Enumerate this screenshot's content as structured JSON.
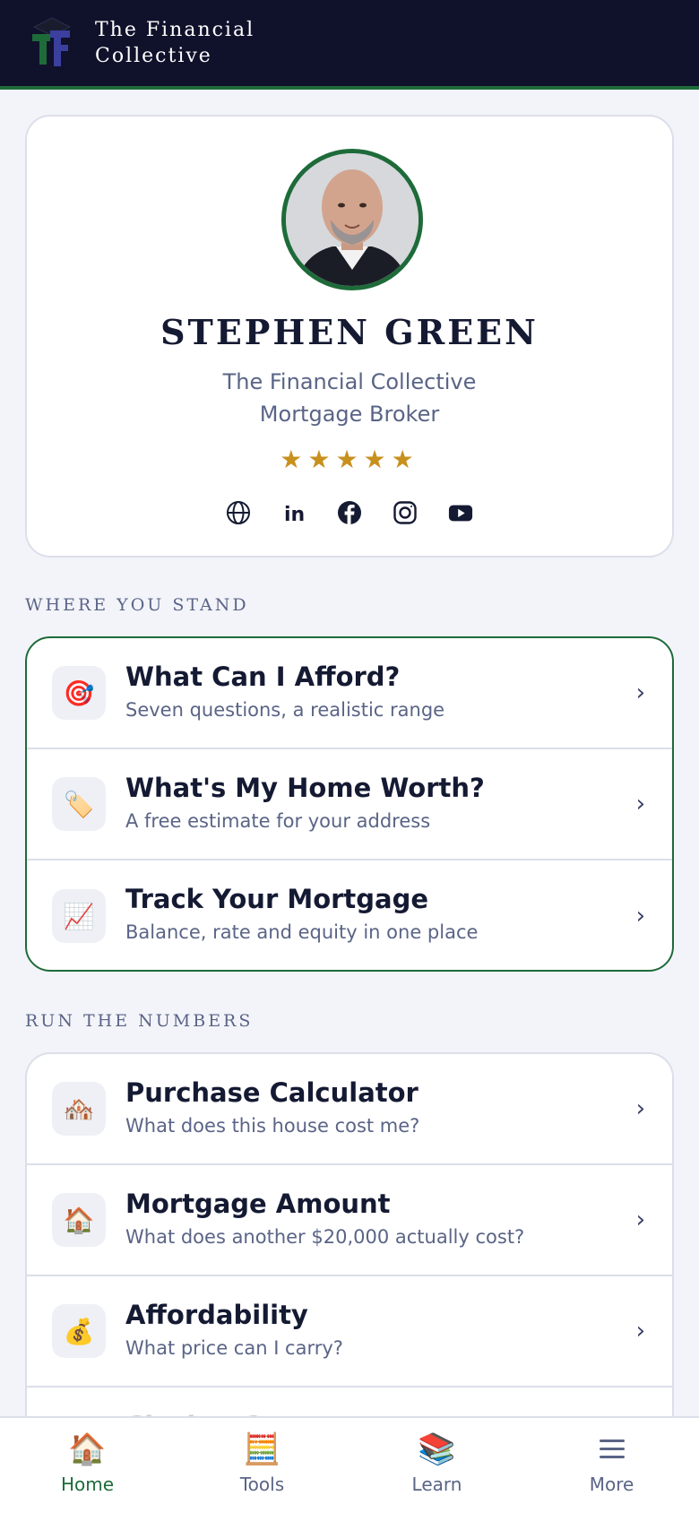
{
  "header": {
    "brand_line1": "The Financial",
    "brand_line2": "Collective"
  },
  "profile": {
    "name": "STEPHEN GREEN",
    "company": "The Financial Collective",
    "role": "Mortgage Broker",
    "stars": "★★★★★",
    "rating": 5,
    "socials": [
      "globe-icon",
      "linkedin-icon",
      "facebook-icon",
      "instagram-icon",
      "youtube-icon"
    ]
  },
  "sections": {
    "stand": "WHERE YOU STAND",
    "numbers": "RUN THE NUMBERS"
  },
  "stand_items": [
    {
      "icon": "🎯",
      "title": "What Can I Afford?",
      "desc": "Seven questions, a realistic range"
    },
    {
      "icon": "🏷️",
      "title": "What's My Home Worth?",
      "desc": "A free estimate for your address"
    },
    {
      "icon": "📈",
      "title": "Track Your Mortgage",
      "desc": "Balance, rate and equity in one place"
    }
  ],
  "number_items": [
    {
      "icon": "🏘️",
      "title": "Purchase Calculator",
      "desc": "What does this house cost me?"
    },
    {
      "icon": "🏠",
      "title": "Mortgage Amount",
      "desc": "What does another $20,000 actually cost?"
    },
    {
      "icon": "💰",
      "title": "Affordability",
      "desc": "What price can I carry?"
    },
    {
      "icon": "",
      "title": "Closing Costs",
      "desc": ""
    }
  ],
  "chevron": "›",
  "nav": [
    {
      "icon": "🏠",
      "label": "Home"
    },
    {
      "icon": "🧮",
      "label": "Tools"
    },
    {
      "icon": "📚",
      "label": "Learn"
    },
    {
      "icon": "",
      "label": "More"
    }
  ],
  "colors": {
    "header_bg": "#10112b",
    "accent_green": "#1e6b3a",
    "star_gold": "#c8901d",
    "text_dark": "#151a33",
    "text_muted": "#5a6486"
  }
}
